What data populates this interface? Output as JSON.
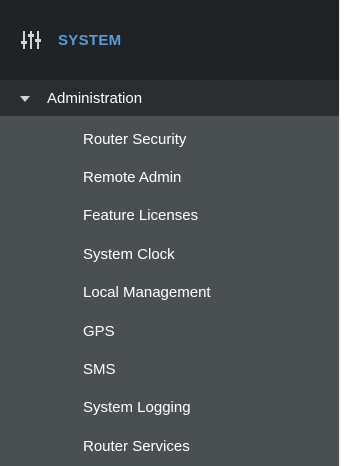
{
  "header": {
    "title": "SYSTEM",
    "icon": "sliders-icon"
  },
  "section": {
    "label": "Administration",
    "expanded": true
  },
  "menu": {
    "items": [
      {
        "label": "Router Security"
      },
      {
        "label": "Remote Admin"
      },
      {
        "label": "Feature Licenses"
      },
      {
        "label": "System Clock"
      },
      {
        "label": "Local Management"
      },
      {
        "label": "GPS"
      },
      {
        "label": "SMS"
      },
      {
        "label": "System Logging"
      },
      {
        "label": "Router Services"
      }
    ]
  },
  "colors": {
    "header_bg": "#1f2326",
    "title_accent": "#5c9bd1",
    "section_bg": "#2a2e31",
    "menu_bg": "#4a4f52",
    "text": "#ffffff"
  }
}
